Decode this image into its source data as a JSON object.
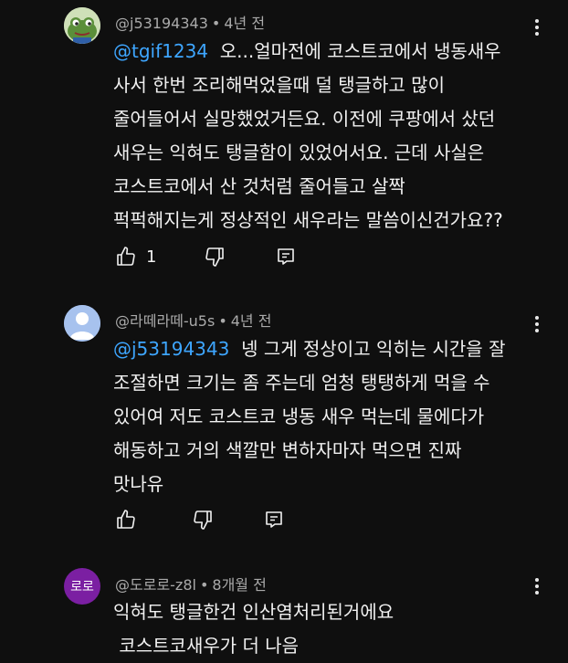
{
  "comments": [
    {
      "author": "@j53194343",
      "separator": "•",
      "time": "4년 전",
      "mention": "@tgif1234",
      "lines": [
        "오...얼마전에 코스트코에서 냉동새우",
        "사서 한번 조리해먹었을때 덜 탱글하고 많이",
        "줄어들어서 실망했었거든요. 이전에 쿠팡에서 샀던",
        "새우는 익혀도 탱글함이 있었어서요. 근데 사실은",
        "코스트코에서 산 것처럼 줄어들고 살짝",
        "퍽퍽해지는게 정상적인 새우라는 말씀이신건가요??"
      ],
      "likes": "1"
    },
    {
      "author": "@라떼라떼-u5s",
      "separator": "•",
      "time": "4년 전",
      "mention": "@j53194343",
      "lines": [
        "넹 그게 정상이고 익히는 시간을 잘",
        "조절하면 크기는 좀 주는데 엄청 탱탱하게 먹을 수",
        "있어여 저도 코스트코 냉동 새우 먹는데 물에다가",
        "해동하고 거의 색깔만 변하자마자 먹으면 진짜",
        "맛나유"
      ],
      "likes": ""
    },
    {
      "author": "@도로로-z8l",
      "separator": "•",
      "time": "8개월 전",
      "avatar_text": "로로",
      "lines": [
        "익혀도 탱글한건 인산염처리된거에요",
        " 코스트코새우가 더 나음"
      ]
    }
  ],
  "icons": {
    "like": "thumbs-up-icon",
    "dislike": "thumbs-down-icon",
    "reply": "reply-icon",
    "more": "more-vert-icon"
  },
  "colors": {
    "background": "#0f0f0f",
    "mention": "#3ea6ff",
    "meta_text": "#aaaaaa",
    "avatar3_bg": "#7b1fa2"
  }
}
